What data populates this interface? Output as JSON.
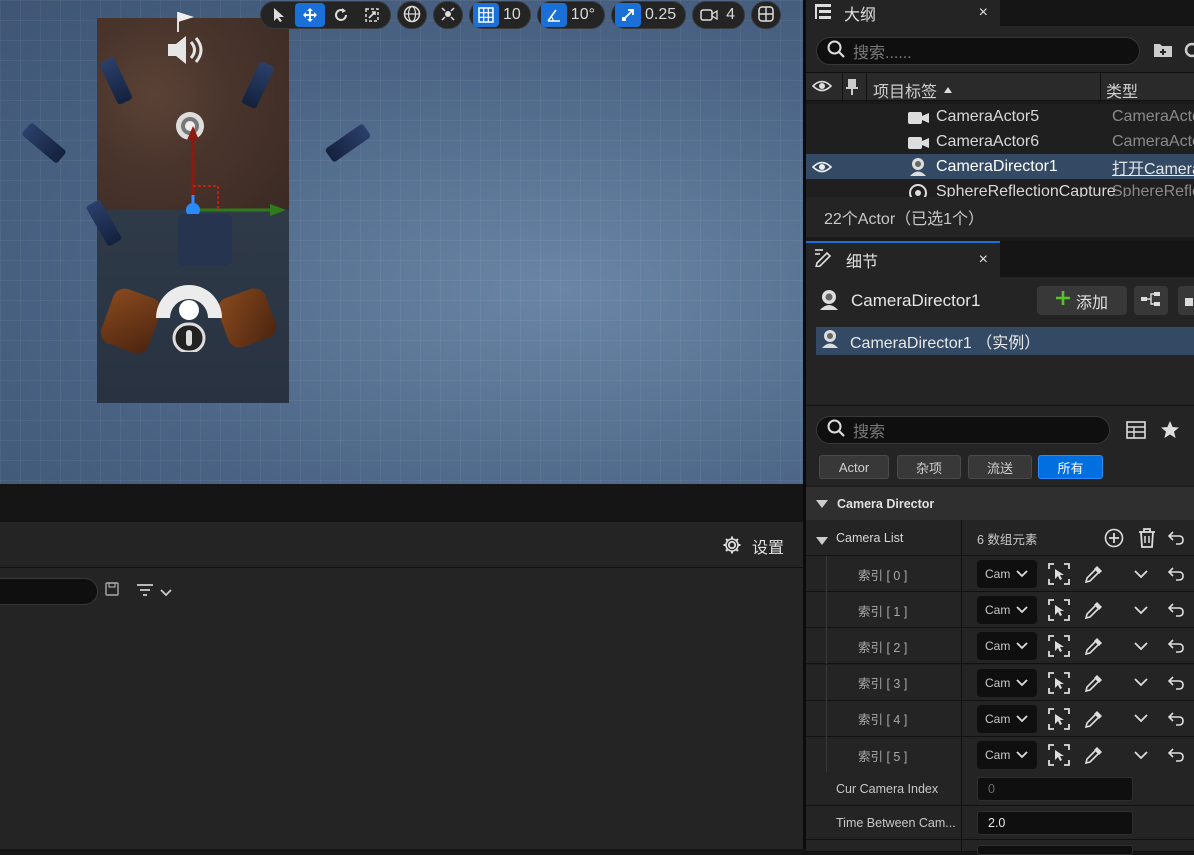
{
  "viewport": {
    "toolbar": {
      "grid_snap_value": "10",
      "rotation_snap_value": "10°",
      "scale_snap_value": "0.25",
      "camera_speed_value": "4"
    }
  },
  "lower_panel": {
    "settings_label": "设置"
  },
  "outliner": {
    "tab_title": "大纲",
    "close_glyph": "×",
    "search_placeholder": "搜索......",
    "col_label": "项目标签",
    "col_type": "类型",
    "rows": [
      {
        "label": "CameraActor5",
        "type": "CameraActor",
        "selected": false
      },
      {
        "label": "CameraActor6",
        "type": "CameraActor",
        "selected": false
      },
      {
        "label": "CameraDirector1",
        "type": "打开CameraDirector",
        "selected": true
      },
      {
        "label": "SphereReflectionCapture",
        "type": "SphereReflectionCapture",
        "selected": false
      }
    ],
    "status": "22个Actor（已选1个）"
  },
  "details": {
    "tab_title": "细节",
    "close_glyph": "×",
    "actor_name": "CameraDirector1",
    "add_label": "添加",
    "component_row": "CameraDirector1 （实例）",
    "search_placeholder": "搜索",
    "filters": [
      "Actor",
      "杂项",
      "流送",
      "所有"
    ],
    "active_filter_index": 3,
    "section_title": "Camera Director",
    "camera_list_label": "Camera List",
    "camera_list_count": "6 数组元素",
    "indices": [
      "索引 [ 0 ]",
      "索引 [ 1 ]",
      "索引 [ 2 ]",
      "索引 [ 3 ]",
      "索引 [ 4 ]",
      "索引 [ 5 ]"
    ],
    "combo_text": "Cam",
    "cur_camera_index_label": "Cur Camera Index",
    "cur_camera_index_value": "0",
    "time_between_label": "Time Between Cam...",
    "time_between_value": "2.0"
  },
  "colors": {
    "accent_blue": "#1a70d6",
    "selection": "#344a64",
    "viewport_bg": "#4f6b8c"
  }
}
